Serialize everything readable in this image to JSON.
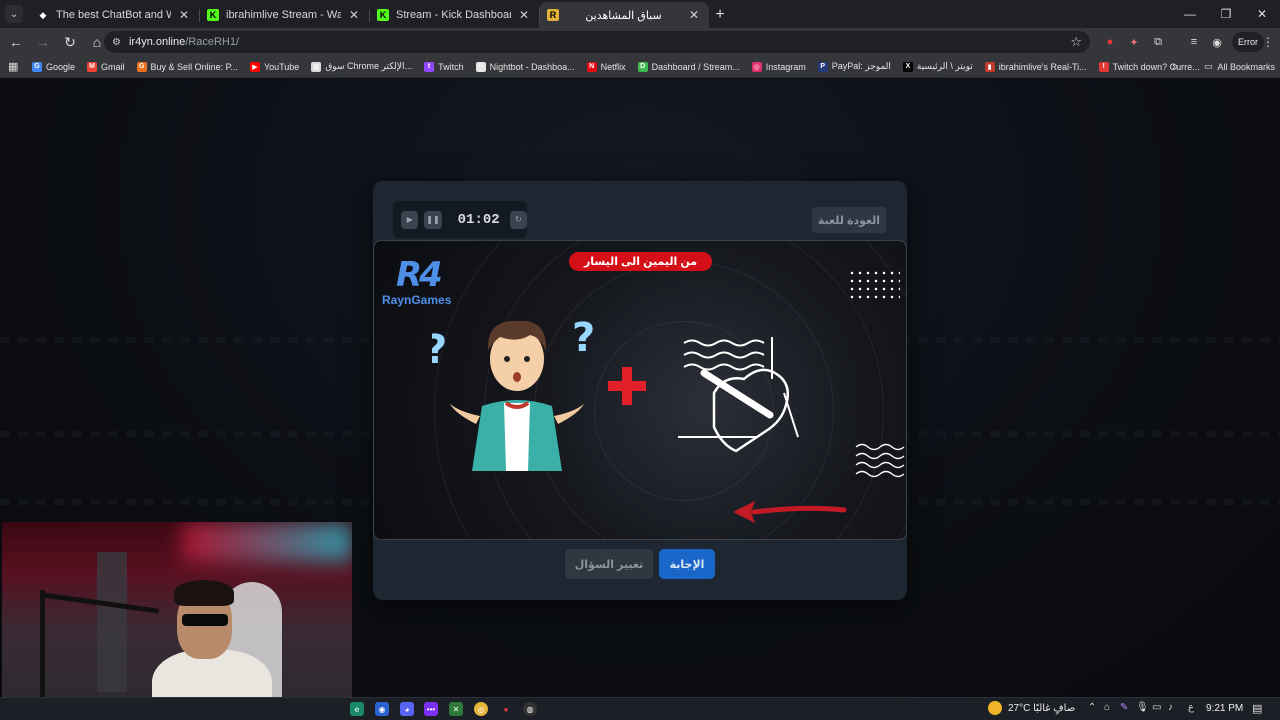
{
  "browser": {
    "tabs": [
      {
        "title": "The best ChatBot and Widgets f",
        "favicon_color": "#ffffff",
        "favicon_glyph": "◆",
        "active": false
      },
      {
        "title": "ibrahimlive Stream - Watch Liv",
        "favicon_color": "#53fc18",
        "favicon_glyph": "K",
        "active": false
      },
      {
        "title": "Stream - Kick Dashboard",
        "favicon_color": "#53fc18",
        "favicon_glyph": "K",
        "active": false
      },
      {
        "title": "سباق المشاهدين",
        "favicon_color": "#e0b23a",
        "favicon_glyph": "R",
        "active": true
      }
    ],
    "url_host": "ir4yn.online",
    "url_path": "/RaceRH1/",
    "error_label": "Error",
    "bookmarks": [
      {
        "label": "Google",
        "color": "#4285f4",
        "glyph": "G"
      },
      {
        "label": "Gmail",
        "color": "#ea4335",
        "glyph": "M"
      },
      {
        "label": "Buy & Sell Online: P...",
        "color": "#e8711a",
        "glyph": "G"
      },
      {
        "label": "YouTube",
        "color": "#ff0000",
        "glyph": "▶"
      },
      {
        "label": "سوق Chrome الإلكتر...",
        "color": "#d9d9d9",
        "glyph": "▦"
      },
      {
        "label": "Twitch",
        "color": "#9146ff",
        "glyph": "t"
      },
      {
        "label": "Nightbot - Dashboa...",
        "color": "#e6e6e6",
        "glyph": "☺"
      },
      {
        "label": "Netflix",
        "color": "#e50914",
        "glyph": "N"
      },
      {
        "label": "Dashboard / Stream...",
        "color": "#3fb950",
        "glyph": "D"
      },
      {
        "label": "Instagram",
        "color": "#e1306c",
        "glyph": "◎"
      },
      {
        "label": "PayPal: الموجز",
        "color": "#253b80",
        "glyph": "P"
      },
      {
        "label": "تويتر \\ الرئيسية",
        "color": "#000000",
        "glyph": "X"
      },
      {
        "label": "ibrahimlive's Real-Ti...",
        "color": "#c0392b",
        "glyph": "▮"
      },
      {
        "label": "Twitch down? Curre...",
        "color": "#e53935",
        "glyph": "!"
      }
    ],
    "all_bookmarks_label": "All Bookmarks"
  },
  "game": {
    "timer": "01:02",
    "back_label": "العودة للعبة",
    "hint": "من اليمين الى اليسار",
    "logo_mark": "R4",
    "logo_name": "RaynGames",
    "change_question_label": "تغيير السؤال",
    "answer_label": "الإجابة"
  },
  "taskbar": {
    "weather": "27°C  صافٍ غالبًا",
    "lang": "ع",
    "time": "9:21 PM"
  }
}
